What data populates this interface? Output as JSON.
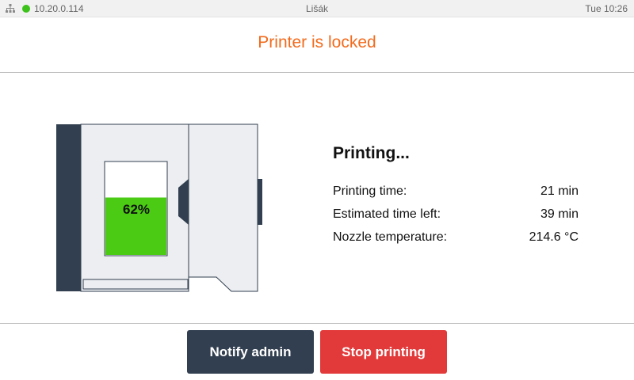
{
  "status_bar": {
    "network_icon": "network-icon",
    "connection_status_color": "#3cc21b",
    "ip_address": "10.20.0.114",
    "hostname": "Lišák",
    "clock": "Tue 10:26"
  },
  "header": {
    "title": "Printer is locked",
    "title_color": "#f26a1b"
  },
  "printer": {
    "progress_text": "62%",
    "progress_fraction": 0.62,
    "progress_color": "#4bcb14"
  },
  "info": {
    "heading": "Printing...",
    "rows": [
      {
        "label": "Printing time:",
        "value": "21 min"
      },
      {
        "label": "Estimated time left:",
        "value": "39 min"
      },
      {
        "label": "Nozzle temperature:",
        "value": "214.6 °C"
      }
    ]
  },
  "buttons": {
    "notify_label": "Notify admin",
    "notify_color": "#323f50",
    "stop_label": "Stop printing",
    "stop_color": "#e23a3a"
  }
}
